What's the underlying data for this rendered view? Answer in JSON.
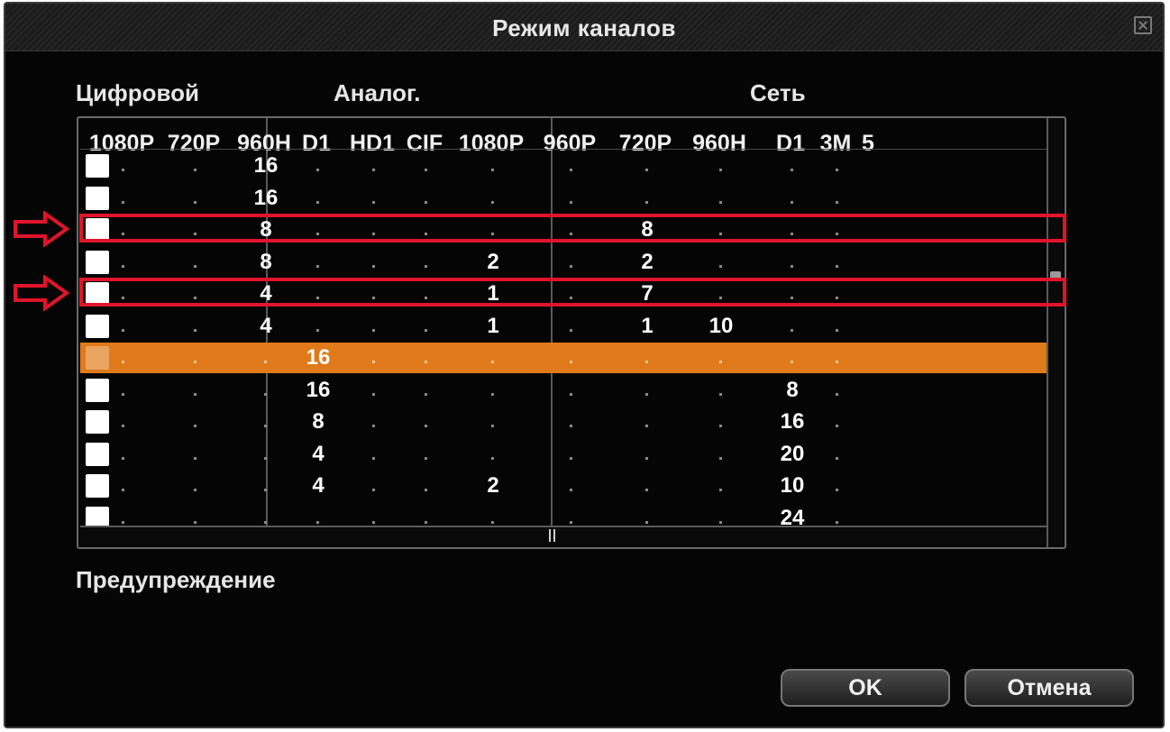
{
  "dialog": {
    "title": "Режим каналов"
  },
  "groups": {
    "digital": "Цифровой",
    "analog": "Аналог.",
    "network": "Сеть"
  },
  "columns": [
    "1080P",
    "720P",
    "960H",
    "D1",
    "HD1",
    "CIF",
    "1080P",
    "960P",
    "720P",
    "960H",
    "D1",
    "3M",
    "5"
  ],
  "rows": [
    {
      "selected": false,
      "cells": [
        ".",
        ".",
        "16",
        ".",
        ".",
        ".",
        ".",
        ".",
        ".",
        ".",
        ".",
        ".",
        ""
      ]
    },
    {
      "selected": false,
      "cells": [
        ".",
        ".",
        "16",
        ".",
        ".",
        ".",
        ".",
        ".",
        ".",
        ".",
        ".",
        ".",
        ""
      ]
    },
    {
      "selected": false,
      "cells": [
        ".",
        ".",
        "8",
        ".",
        ".",
        ".",
        ".",
        ".",
        "8",
        ".",
        ".",
        ".",
        ""
      ]
    },
    {
      "selected": false,
      "cells": [
        ".",
        ".",
        "8",
        ".",
        ".",
        ".",
        "2",
        ".",
        "2",
        ".",
        ".",
        ".",
        ""
      ]
    },
    {
      "selected": false,
      "cells": [
        ".",
        ".",
        "4",
        ".",
        ".",
        ".",
        "1",
        ".",
        "7",
        ".",
        ".",
        ".",
        ""
      ]
    },
    {
      "selected": false,
      "cells": [
        ".",
        ".",
        "4",
        ".",
        ".",
        ".",
        "1",
        ".",
        "1",
        "10",
        ".",
        ".",
        ""
      ]
    },
    {
      "selected": true,
      "cells": [
        ".",
        ".",
        ".",
        "16",
        ".",
        ".",
        ".",
        ".",
        ".",
        ".",
        ".",
        ".",
        ""
      ]
    },
    {
      "selected": false,
      "cells": [
        ".",
        ".",
        ".",
        "16",
        ".",
        ".",
        ".",
        ".",
        ".",
        ".",
        "8",
        ".",
        ""
      ]
    },
    {
      "selected": false,
      "cells": [
        ".",
        ".",
        ".",
        "8",
        ".",
        ".",
        ".",
        ".",
        ".",
        ".",
        "16",
        ".",
        ""
      ]
    },
    {
      "selected": false,
      "cells": [
        ".",
        ".",
        ".",
        "4",
        ".",
        ".",
        ".",
        ".",
        ".",
        ".",
        "20",
        ".",
        ""
      ]
    },
    {
      "selected": false,
      "cells": [
        ".",
        ".",
        ".",
        "4",
        ".",
        ".",
        "2",
        ".",
        ".",
        ".",
        "10",
        ".",
        ""
      ]
    },
    {
      "selected": false,
      "cells": [
        ".",
        ".",
        ".",
        ".",
        ".",
        ".",
        ".",
        ".",
        ".",
        ".",
        "24",
        ".",
        ""
      ]
    }
  ],
  "highlighted_rows": [
    2,
    4
  ],
  "warning_label": "Предупреждение",
  "buttons": {
    "ok": "OK",
    "cancel": "Отмена"
  },
  "colors": {
    "selected_row": "#e07a1a",
    "highlight": "#e0142a"
  }
}
